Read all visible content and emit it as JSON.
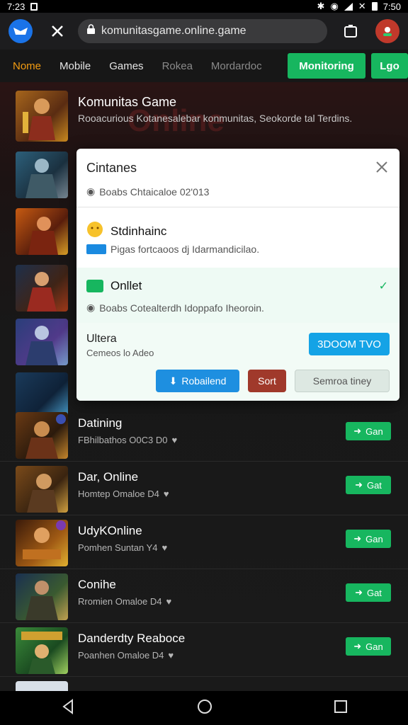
{
  "status_bar": {
    "time": "7:23",
    "right_time": "7:50"
  },
  "browser": {
    "url": "komunitasgame.online.game"
  },
  "nav": {
    "tabs": [
      "Nome",
      "Mobile",
      "Games",
      "Rokea",
      "Mordardoc"
    ],
    "primary_button": "Monitoring",
    "login_button": "Lgo"
  },
  "hero": {
    "title": "Komunitas Game",
    "subtitle": "Rooacurious Kotanesalebar konmunitas, Seokorde tal Terdins.",
    "bg_text": "Online"
  },
  "dialog": {
    "title": "Cintanes",
    "meta_line": "Boabs Chtaicaloe 02'013",
    "section_title": "Stdinhainc",
    "section_desc": "Pigas fortcaoos dj Idarmandicilao.",
    "online_title": "Onllet",
    "online_desc": "Boabs Cotealterdh Idoppafo Iheoroin.",
    "filter_title": "Ultera",
    "filter_desc": "Cemeos lo Adeo",
    "price_button": "3DOOM TVO",
    "download_button": "Robailend",
    "sort_button": "Sort",
    "semi_button": "Semroa tiney"
  },
  "games": [
    {
      "title": "Datining",
      "sub": "FBhilbathos O0C3 D0",
      "button": "Gan"
    },
    {
      "title": "Dar, Online",
      "sub": "Homtep Omaloe D4",
      "button": "Gat"
    },
    {
      "title": "UdyKOnline",
      "sub": "Pomhen Suntan Y4",
      "button": "Gan"
    },
    {
      "title": "Conihe",
      "sub": "Rromien Omaloe D4",
      "button": "Gat"
    },
    {
      "title": "Danderdty Reaboce",
      "sub": "Poanhen Omaloe D4",
      "button": "Gan"
    }
  ],
  "colors": {
    "accent_green": "#17b65f",
    "accent_orange": "#f39c12",
    "accent_blue": "#14a3e6",
    "danger": "#a0392b"
  }
}
